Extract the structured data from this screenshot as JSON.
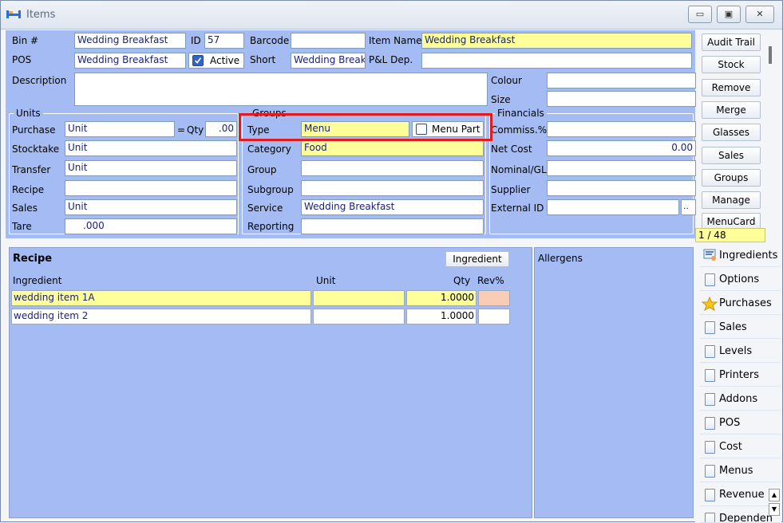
{
  "window": {
    "title": "Items"
  },
  "fields": {
    "bin_label": "Bin #",
    "bin_value": "Wedding Breakfast",
    "id_label": "ID",
    "id_value": "57",
    "barcode_label": "Barcode",
    "barcode_value": "",
    "item_name_label": "Item Name",
    "item_name_value": "Wedding Breakfast",
    "pos_label": "POS",
    "pos_value": "Wedding Breakfast",
    "active_label": "Active",
    "active_checked": true,
    "short_label": "Short",
    "short_value": "Wedding Break",
    "pl_dep_label": "P&L Dep.",
    "pl_dep_value": "",
    "description_label": "Description",
    "description_value": "",
    "colour_label": "Colour",
    "colour_value": "",
    "size_label": "Size",
    "size_value": ""
  },
  "units": {
    "title": "Units",
    "purchase_label": "Purchase",
    "purchase_value": "Unit",
    "eq_label": "=",
    "qty_label": "Qty",
    "qty_value": ".00",
    "stocktake_label": "Stocktake",
    "stocktake_value": "Unit",
    "transfer_label": "Transfer",
    "transfer_value": "Unit",
    "recipe_label": "Recipe",
    "recipe_value": "",
    "sales_label": "Sales",
    "sales_value": "Unit",
    "tare_label": "Tare",
    "tare_value": ".000"
  },
  "groups": {
    "title": "Groups",
    "type_label": "Type",
    "type_value": "Menu",
    "menu_part_label": "Menu Part",
    "menu_part_checked": false,
    "category_label": "Category",
    "category_value": "Food",
    "group_label": "Group",
    "group_value": "",
    "subgroup_label": "Subgroup",
    "subgroup_value": "",
    "service_label": "Service",
    "service_value": "Wedding Breakfast",
    "reporting_label": "Reporting",
    "reporting_value": ""
  },
  "financials": {
    "title": "Financials",
    "commiss_label": "Commiss.%",
    "commiss_value": "",
    "net_cost_label": "Net Cost",
    "net_cost_value": "0.00",
    "nominal_label": "Nominal/GL",
    "nominal_value": "",
    "supplier_label": "Supplier",
    "supplier_value": "",
    "external_id_label": "External ID",
    "external_id_value": "",
    "ellipsis_label": ".."
  },
  "right_buttons": [
    "Audit Trail",
    "Stock",
    "Remove",
    "Merge",
    "Glasses",
    "Sales",
    "Groups",
    "Manage",
    "MenuCard"
  ],
  "record_counter": "1 / 48",
  "recipe": {
    "title": "Recipe",
    "ingredient_button": "Ingredient",
    "columns": {
      "ingredient": "Ingredient",
      "unit": "Unit",
      "qty": "Qty",
      "rev": "Rev%"
    },
    "rows": [
      {
        "ingredient": "wedding item 1A",
        "unit": "",
        "qty": "1.0000",
        "rev": ""
      },
      {
        "ingredient": "wedding item 2",
        "unit": "",
        "qty": "1.0000",
        "rev": ""
      }
    ]
  },
  "allergens": {
    "title": "Allergens"
  },
  "side_tabs": [
    {
      "label": "Ingredients",
      "icon": "ingredients-icon"
    },
    {
      "label": "Options",
      "icon": "document-icon"
    },
    {
      "label": "Purchases",
      "icon": "star-icon"
    },
    {
      "label": "Sales",
      "icon": "document-icon"
    },
    {
      "label": "Levels",
      "icon": "document-icon"
    },
    {
      "label": "Printers",
      "icon": "document-icon"
    },
    {
      "label": "Addons",
      "icon": "document-icon"
    },
    {
      "label": "POS",
      "icon": "document-icon"
    },
    {
      "label": "Cost",
      "icon": "document-icon"
    },
    {
      "label": "Menus",
      "icon": "document-icon"
    },
    {
      "label": "Revenue",
      "icon": "document-icon"
    },
    {
      "label": "Dependen",
      "icon": "document-icon"
    }
  ],
  "colors": {
    "panel": "#a4bcf3",
    "highlight_field": "#ffff99",
    "annotation_box": "#e01c1c",
    "rev_cell": "#f9cdb5"
  }
}
